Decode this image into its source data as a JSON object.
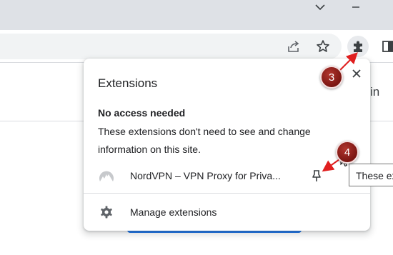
{
  "browser": {
    "titlebar": {
      "chevron_icon": "chevron-down-icon",
      "minimize_icon": "minimize-icon"
    },
    "toolbar": {
      "share_icon": "share-icon",
      "bookmark_icon": "star-icon",
      "extensions_icon": "puzzle-icon",
      "sidepanel_icon": "side-panel-icon"
    }
  },
  "page": {
    "signin_partial": "in"
  },
  "extensions_popup": {
    "title": "Extensions",
    "close_icon": "close-icon",
    "section_heading": "No access needed",
    "section_description": "These extensions don't need to see and change information on this site.",
    "extensions": [
      {
        "name": "NordVPN – VPN Proxy for Priva...",
        "icon": "nordvpn-icon",
        "pin_icon": "pin-icon"
      }
    ],
    "manage_label": "Manage extensions",
    "manage_icon": "gear-icon"
  },
  "tooltip": {
    "text": "These ex"
  },
  "annotations": {
    "step_badges": [
      "3",
      "4"
    ],
    "color": "#7a1612"
  }
}
